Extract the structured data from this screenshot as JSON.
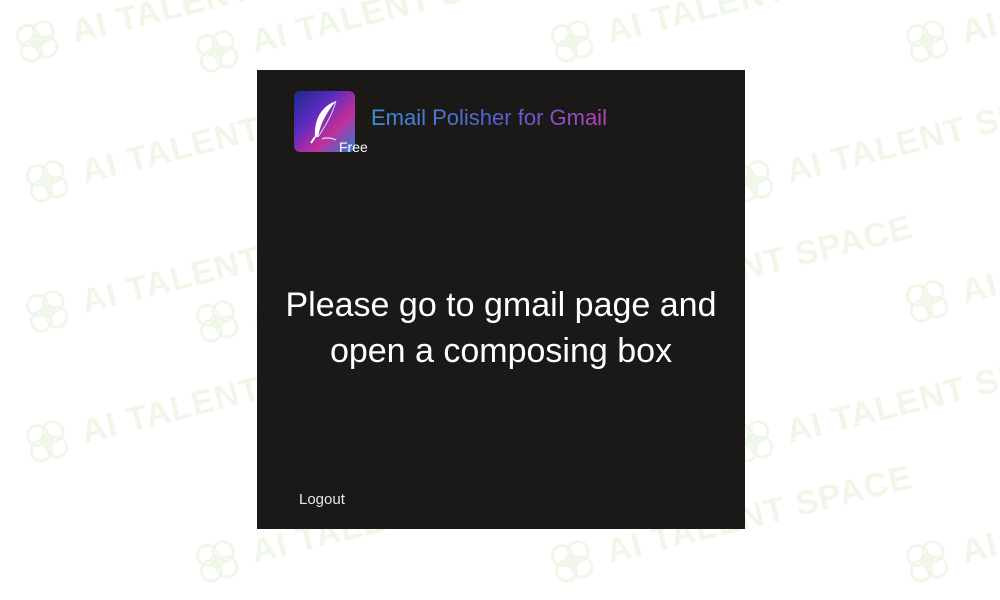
{
  "watermark": {
    "text": "AI TALENT SPACE"
  },
  "popup": {
    "title": "Email Polisher for Gmail",
    "badge": "Free",
    "message_line1": "Please go to gmail page and",
    "message_line2": "open a composing box",
    "logout_label": "Logout",
    "icon": "feather-quill-icon"
  },
  "colors": {
    "panel_bg": "#1a1917",
    "title_gradient_start": "#3a8fd8",
    "title_gradient_end": "#b73fc0",
    "watermark": "#a6d27a"
  }
}
